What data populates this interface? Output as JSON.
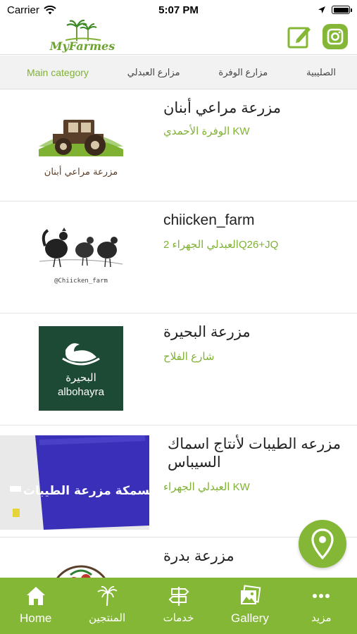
{
  "status": {
    "carrier": "Carrier",
    "time": "5:07 PM"
  },
  "header": {
    "logo_text": "MyFarmes"
  },
  "categories": [
    {
      "label": "Main category",
      "active": true
    },
    {
      "label": "مزارع العبدلي",
      "active": false
    },
    {
      "label": "مزارع الوفرة",
      "active": false
    },
    {
      "label": "الصليبية",
      "active": false
    }
  ],
  "farms": [
    {
      "title": "مزرعة مراعي أبنان",
      "subtitle": "الوفرة الأحمدي KW",
      "thumb_caption": "مزرعة مراعي أبنان"
    },
    {
      "title": "chiicken_farm",
      "subtitle": "العبدلي الجهراء 2Q26+JQ",
      "thumb_caption": "@Chiicken_farm"
    },
    {
      "title": "مزرعة البحيرة",
      "subtitle": "شارع الفلاح",
      "thumb_caption": "البحيرة",
      "thumb_caption_en": "albohayra"
    },
    {
      "title": "مزرعه الطيبات لأنتاج اسماك السيباس",
      "subtitle": "العبدلي الجهراء KW",
      "thumb_caption": "مسمكة مزرعة الطيبات"
    },
    {
      "title": "مزرعة بدرة",
      "subtitle": ""
    }
  ],
  "tabs": [
    {
      "label": "Home",
      "icon": "home-icon"
    },
    {
      "label": "المنتجين",
      "icon": "palm-tree-icon"
    },
    {
      "label": "خدمات",
      "icon": "signpost-icon"
    },
    {
      "label": "Gallery",
      "icon": "gallery-icon"
    },
    {
      "label": "مزيد",
      "icon": "more-icon"
    }
  ],
  "colors": {
    "accent": "#84b735",
    "accent_text": "#7fb233"
  }
}
